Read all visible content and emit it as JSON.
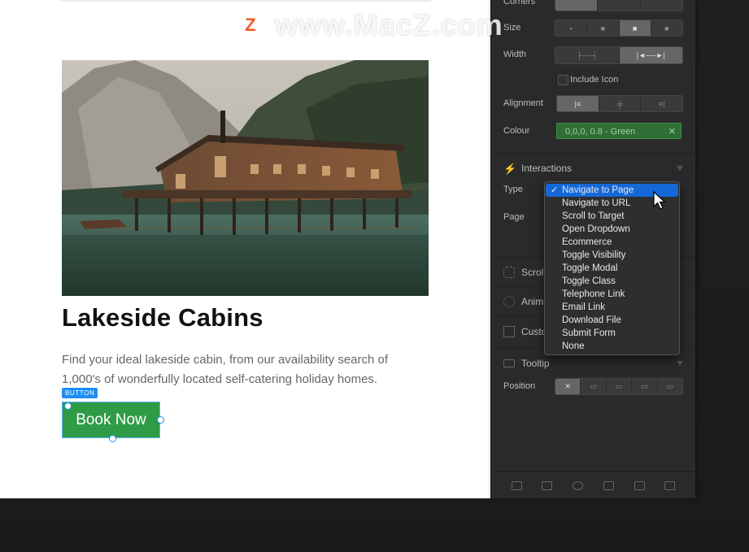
{
  "canvas": {
    "title": "Lakeside Cabins",
    "description": "Find your ideal lakeside cabin, from our availability search of 1,000's of wonderfully located self-catering holiday homes.",
    "selection_tag": "BUTTON",
    "button_label": "Book Now",
    "button_color": "#2f9b46"
  },
  "panel": {
    "corners_label": "Corners",
    "size_label": "Size",
    "width_label": "Width",
    "include_icon_label": "Include Icon",
    "alignment_label": "Alignment",
    "colour_label": "Colour",
    "colour_value": "0,0,0, 0.8 - Green",
    "interactions_label": "Interactions",
    "type_label": "Type",
    "page_label": "Page",
    "scroll_label": "Scroll",
    "animation_label": "Anima",
    "custom_label": "Custo",
    "tooltip_label": "Tooltip",
    "position_label": "Position"
  },
  "dropdown": {
    "selected_index": 0,
    "options": [
      "Navigate to Page",
      "Navigate to URL",
      "Scroll to Target",
      "Open Dropdown",
      "Ecommerce",
      "Toggle Visibility",
      "Toggle Modal",
      "Toggle Class",
      "Telephone Link",
      "Email Link",
      "Download File",
      "Submit Form",
      "None"
    ]
  },
  "watermark": {
    "logo_letter": "Z",
    "text": "www.MacZ.com"
  },
  "colors": {
    "accent": "#1468d8",
    "selection": "#1f8ef1",
    "panel_bg": "#2a2a2c"
  }
}
